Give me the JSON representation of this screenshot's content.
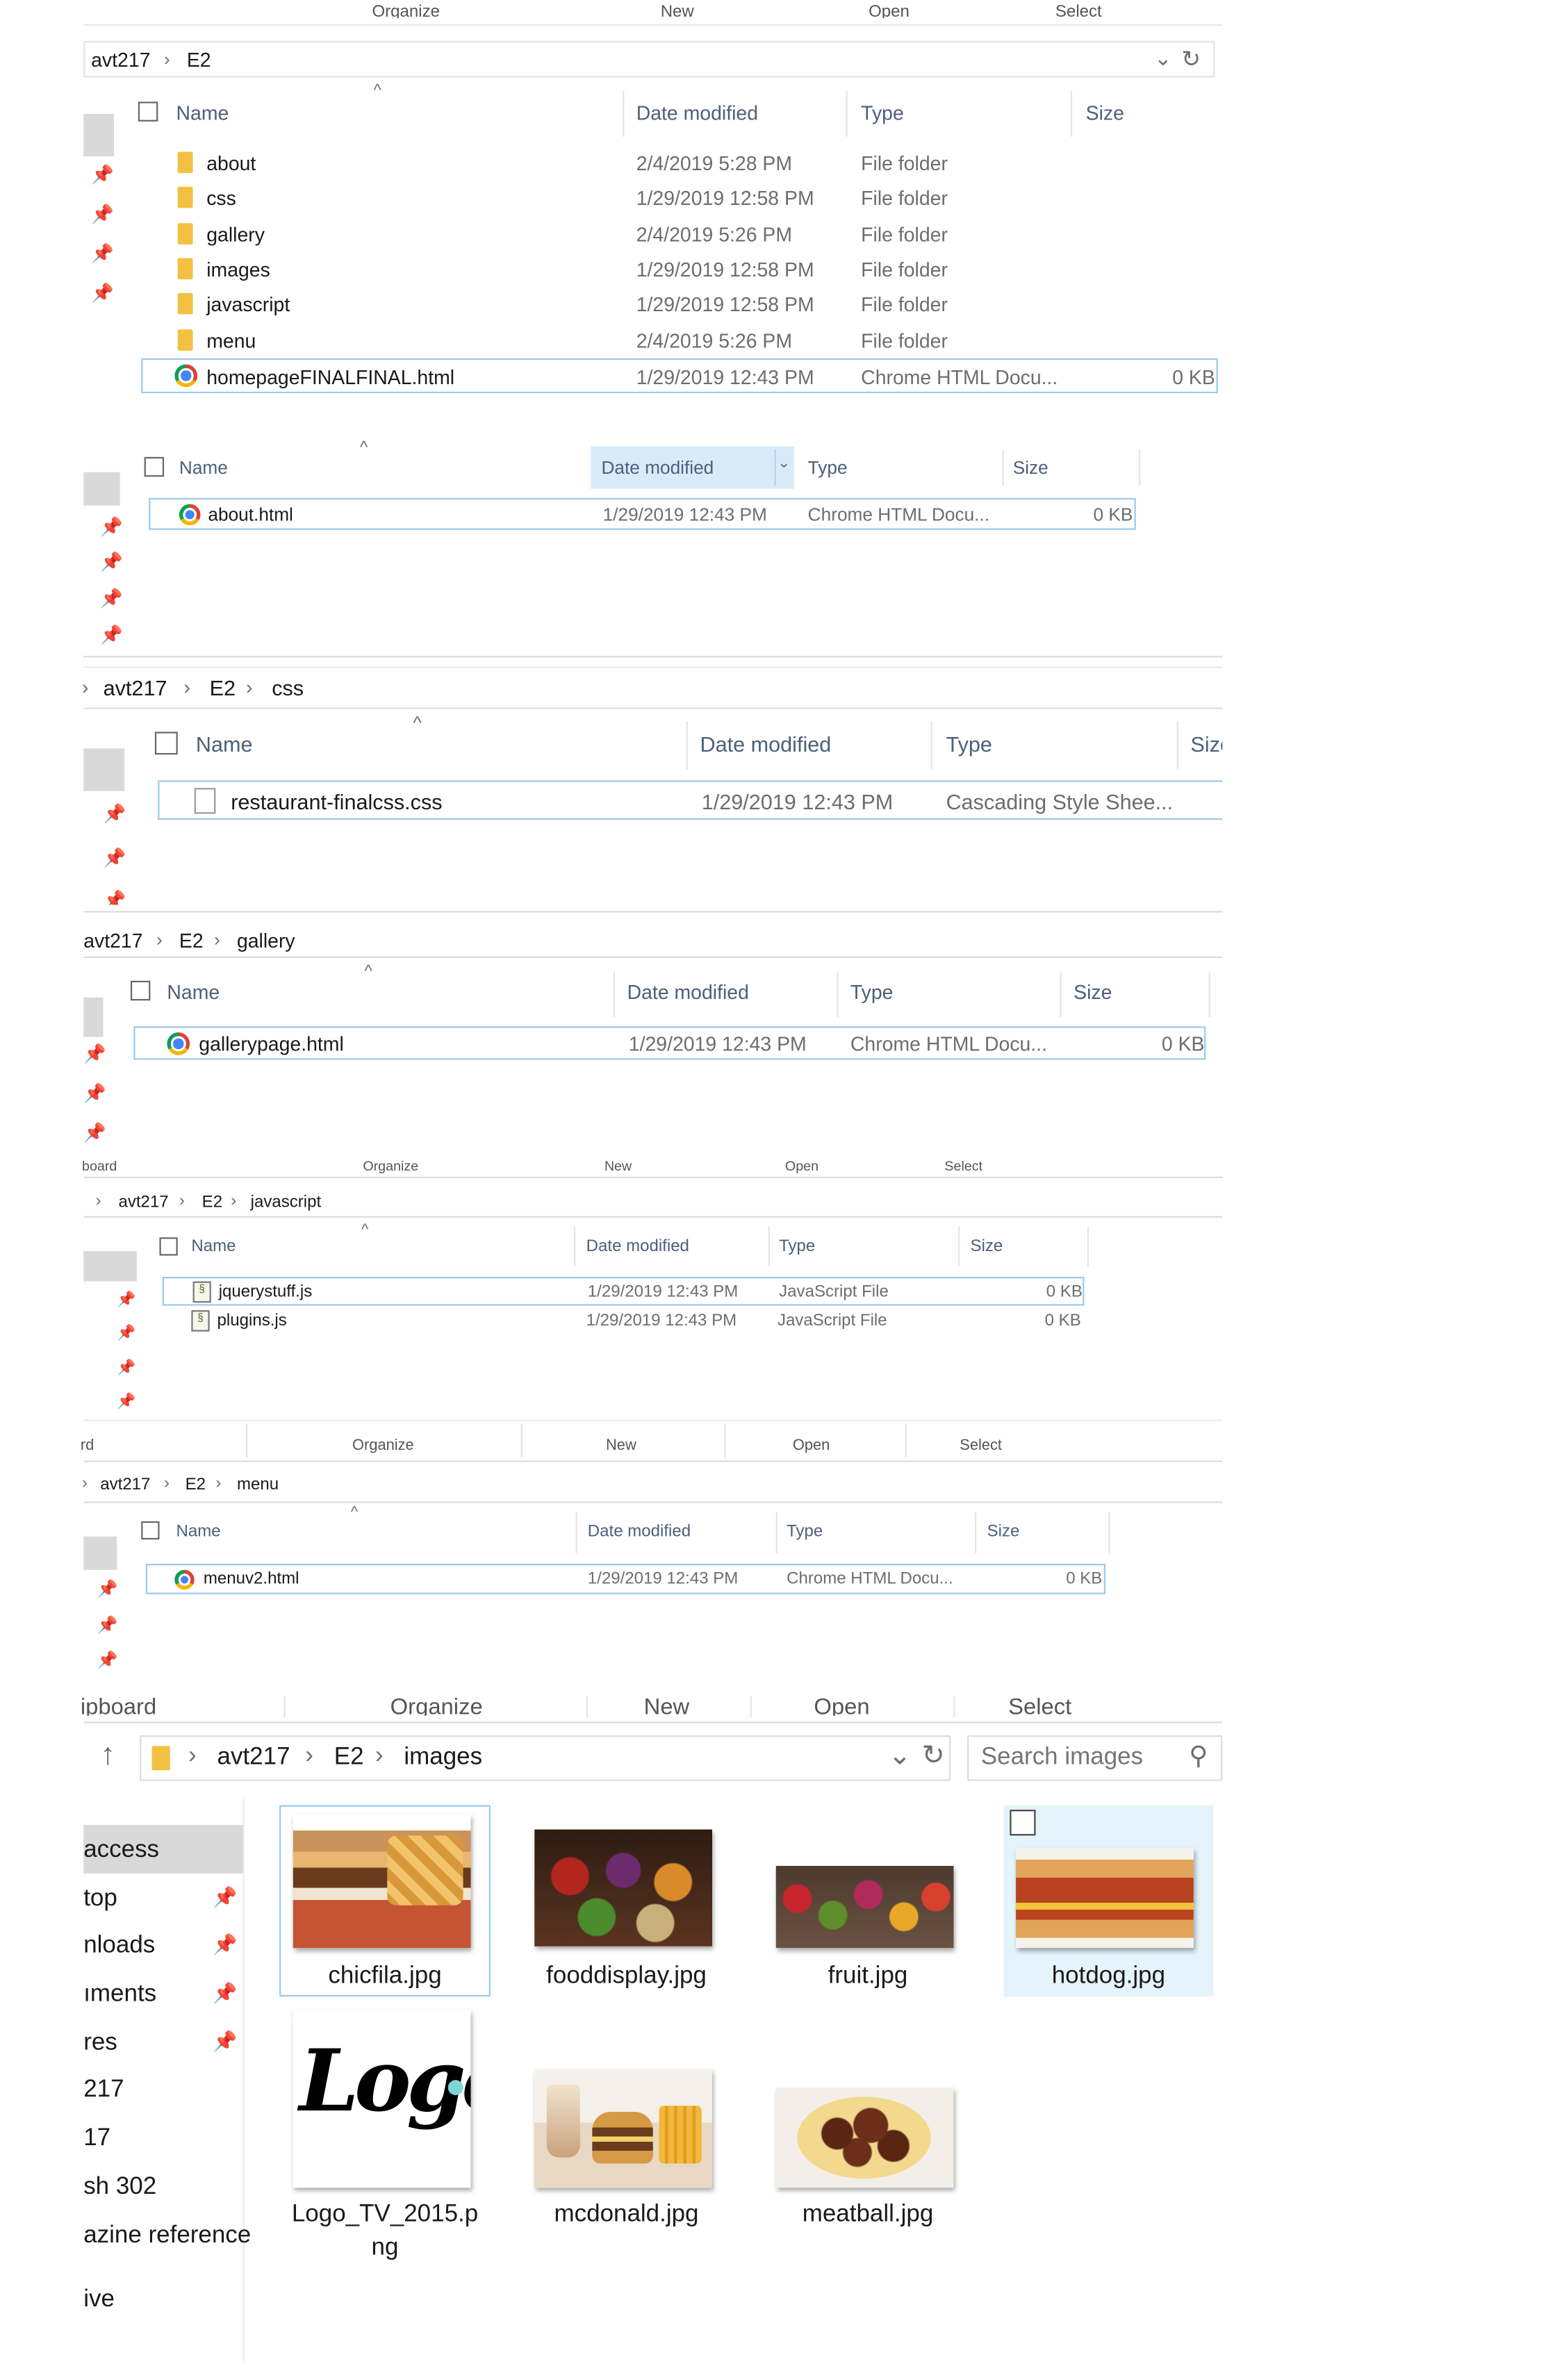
{
  "colors": {
    "selection_border": "#99c9ef",
    "hover_bg": "#e5f3fb",
    "header_text": "#4c607a",
    "chrome_red": "#db4437",
    "folder_yellow": "#f3c042"
  },
  "icons": [
    "pin-icon",
    "folder-icon",
    "chrome-icon",
    "css-file-icon",
    "js-file-icon",
    "up-arrow-icon",
    "refresh-icon",
    "search-icon",
    "chevron-down-icon",
    "sort-arrow-icon"
  ],
  "columns": {
    "name": "Name",
    "date": "Date modified",
    "type": "Type",
    "size": "Size",
    "size_cut": "Size"
  },
  "p1": {
    "ribbon": [
      "Organize",
      "New",
      "Open",
      "Select"
    ],
    "breadcrumb": [
      "avt217",
      "E2"
    ],
    "rows": [
      {
        "name": "about",
        "date": "2/4/2019 5:28 PM",
        "type": "File folder",
        "size": ""
      },
      {
        "name": "css",
        "date": "1/29/2019 12:58 PM",
        "type": "File folder",
        "size": ""
      },
      {
        "name": "gallery",
        "date": "2/4/2019 5:26 PM",
        "type": "File folder",
        "size": ""
      },
      {
        "name": "images",
        "date": "1/29/2019 12:58 PM",
        "type": "File folder",
        "size": ""
      },
      {
        "name": "javascript",
        "date": "1/29/2019 12:58 PM",
        "type": "File folder",
        "size": ""
      },
      {
        "name": "menu",
        "date": "2/4/2019 5:26 PM",
        "type": "File folder",
        "size": ""
      },
      {
        "name": "homepageFINALFINAL.html",
        "date": "1/29/2019 12:43 PM",
        "type": "Chrome HTML Docu...",
        "size": "0 KB"
      }
    ]
  },
  "p2": {
    "rows": [
      {
        "name": "about.html",
        "date": "1/29/2019 12:43 PM",
        "type": "Chrome HTML Docu...",
        "size": "0 KB"
      }
    ]
  },
  "p3": {
    "breadcrumb": [
      "avt217",
      "E2",
      "css"
    ],
    "rows": [
      {
        "name": "restaurant-finalcss.css",
        "date": "1/29/2019 12:43 PM",
        "type": "Cascading Style Shee..."
      }
    ]
  },
  "p4": {
    "breadcrumb": [
      "avt217",
      "E2",
      "gallery"
    ],
    "rows": [
      {
        "name": "gallerypage.html",
        "date": "1/29/2019 12:43 PM",
        "type": "Chrome HTML Docu...",
        "size": "0 KB"
      }
    ]
  },
  "p5": {
    "ribbon": [
      "board",
      "Organize",
      "New",
      "Open",
      "Select"
    ],
    "breadcrumb": [
      "avt217",
      "E2",
      "javascript"
    ],
    "rows": [
      {
        "name": "jquerystuff.js",
        "date": "1/29/2019 12:43 PM",
        "type": "JavaScript File",
        "size": "0 KB"
      },
      {
        "name": "plugins.js",
        "date": "1/29/2019 12:43 PM",
        "type": "JavaScript File",
        "size": "0 KB"
      }
    ]
  },
  "p6": {
    "ribbon": [
      "rd",
      "Organize",
      "New",
      "Open",
      "Select"
    ],
    "breadcrumb": [
      "avt217",
      "E2",
      "menu"
    ],
    "rows": [
      {
        "name": "menuv2.html",
        "date": "1/29/2019 12:43 PM",
        "type": "Chrome HTML Docu...",
        "size": "0 KB"
      }
    ]
  },
  "p7": {
    "ribbon": [
      "ipboard",
      "Organize",
      "New",
      "Open",
      "Select"
    ],
    "breadcrumb": [
      "avt217",
      "E2",
      "images"
    ],
    "search_placeholder": "Search images",
    "nav": [
      "access",
      "top",
      "nloads",
      "ıments",
      "res",
      "217",
      "17",
      "sh 302",
      "azine reference",
      "ive"
    ],
    "tiles": [
      {
        "name": "chicfila.jpg"
      },
      {
        "name": "fooddisplay.jpg"
      },
      {
        "name": "fruit.jpg"
      },
      {
        "name": "hotdog.jpg"
      },
      {
        "name_line1": "Logo_TV_2015.p",
        "name_line2": "ng",
        "logo_text": "Logo"
      },
      {
        "name": "mcdonald.jpg"
      },
      {
        "name": "meatball.jpg"
      }
    ]
  }
}
